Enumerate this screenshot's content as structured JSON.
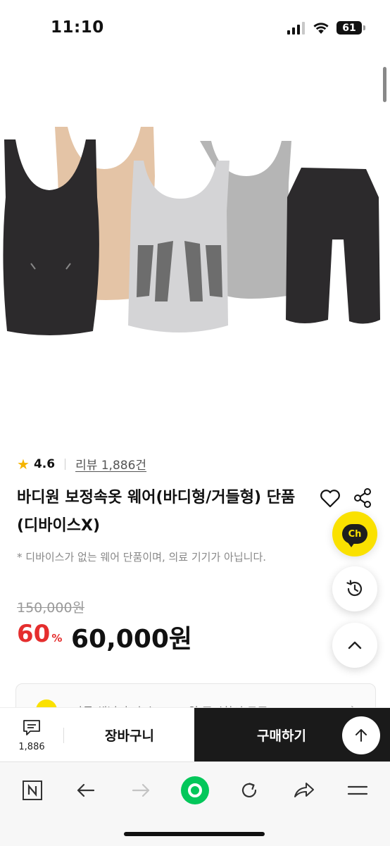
{
  "status_bar": {
    "time": "11:10",
    "battery": "61"
  },
  "rating": {
    "value": "4.6",
    "review_link": "리뷰 1,886건"
  },
  "product": {
    "title": "바디원 보정속옷 웨어(바디형/거들형) 단품 (디바이스X)",
    "notice": "* 디바이스가 없는 웨어 단품이며, 의료 기기가 아닙니다."
  },
  "price": {
    "original": "150,000원",
    "discount_rate": "60",
    "discount_unit": "%",
    "sale": "60,000원"
  },
  "chat_button": {
    "label": "Ch"
  },
  "coupon": {
    "text": "카톡 채널 추가시 5,000원 즉시할인 쿠폰"
  },
  "purchase_bar": {
    "review_count": "1,886",
    "cart_label": "장바구니",
    "buy_label": "구매하기"
  },
  "colors": {
    "accent_red": "#e52e2e",
    "kakao_yellow": "#fae100",
    "naver_green": "#03c75a",
    "buy_bg": "#1a1a1a"
  },
  "icons": {
    "star": "star-icon",
    "heart": "heart-icon",
    "share": "share-icon",
    "history": "history-icon",
    "scroll_top": "chevron-up-icon",
    "review": "chat-lines-icon",
    "up_arrow": "arrow-up-icon",
    "browser": [
      "naver-n-icon",
      "back-arrow-icon",
      "forward-arrow-icon",
      "green-dot-icon",
      "refresh-icon",
      "share-arrow-icon",
      "menu-icon"
    ]
  }
}
